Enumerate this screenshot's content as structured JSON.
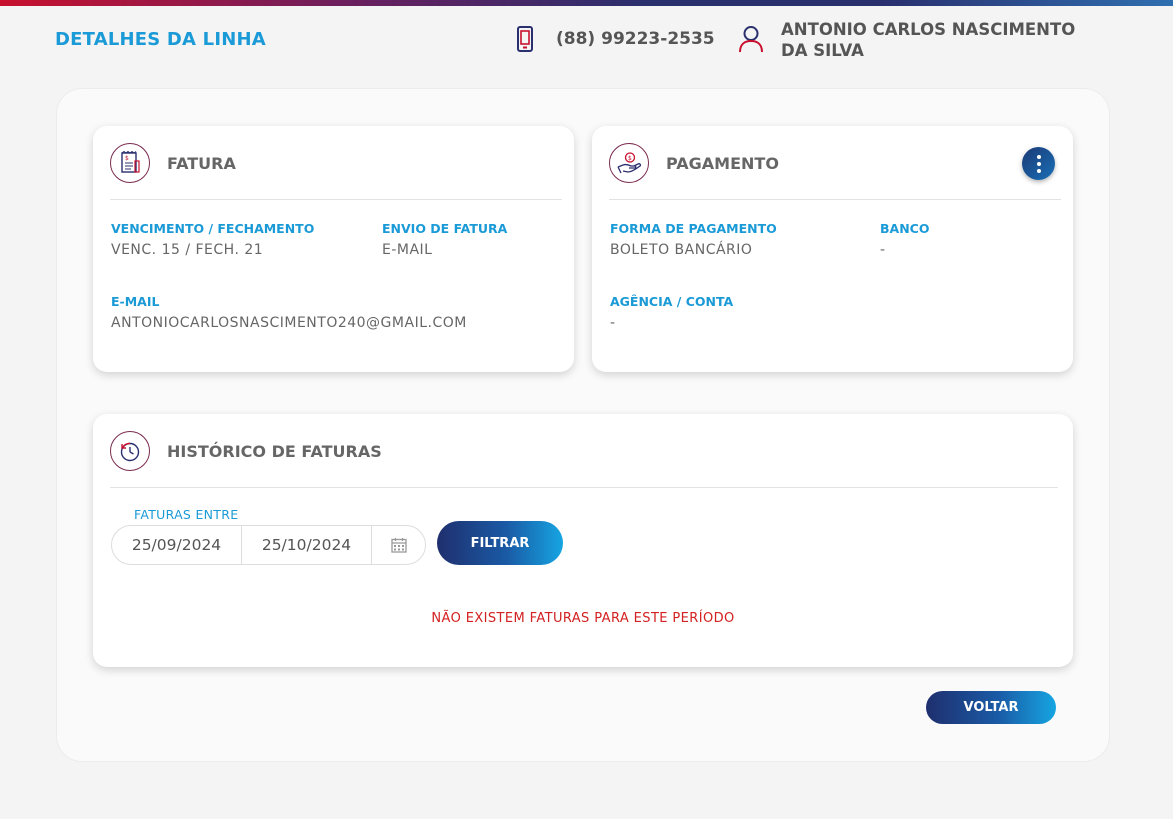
{
  "header": {
    "title": "DETALHES DA LINHA",
    "phone": "(88) 99223-2535",
    "user_name": "ANTONIO CARLOS NASCIMENTO DA SILVA"
  },
  "fatura": {
    "title": "FATURA",
    "vencimento_label": "VENCIMENTO / FECHAMENTO",
    "vencimento_value": "VENC. 15 / FECH. 21",
    "envio_label": "ENVIO DE FATURA",
    "envio_value": "E-MAIL",
    "email_label": "E-MAIL",
    "email_value": "ANTONIOCARLOSNASCIMENTO240@GMAIL.COM"
  },
  "pagamento": {
    "title": "PAGAMENTO",
    "forma_label": "FORMA DE PAGAMENTO",
    "forma_value": "BOLETO BANCÁRIO",
    "banco_label": "BANCO",
    "banco_value": "-",
    "agencia_label": "AGÊNCIA / CONTA",
    "agencia_value": "-"
  },
  "historico": {
    "title": "HISTÓRICO DE FATURAS",
    "filter_label": "FATURAS ENTRE",
    "date_start": "25/09/2024",
    "date_end": "25/10/2024",
    "filter_button": "FILTRAR",
    "empty_message": "NÃO EXISTEM FATURAS PARA ESTE PERÍODO"
  },
  "footer": {
    "back_button": "VOLTAR"
  },
  "colors": {
    "accent_blue": "#1a9ad6",
    "error_red": "#d32020",
    "icon_red": "#c8102e",
    "icon_navy": "#2a2f6e"
  },
  "icons": {
    "phone": "phone-icon",
    "user": "user-icon",
    "invoice": "invoice-icon",
    "payment": "payment-hand-icon",
    "history": "history-clock-icon",
    "calendar": "calendar-icon",
    "menu": "more-vertical-icon"
  }
}
